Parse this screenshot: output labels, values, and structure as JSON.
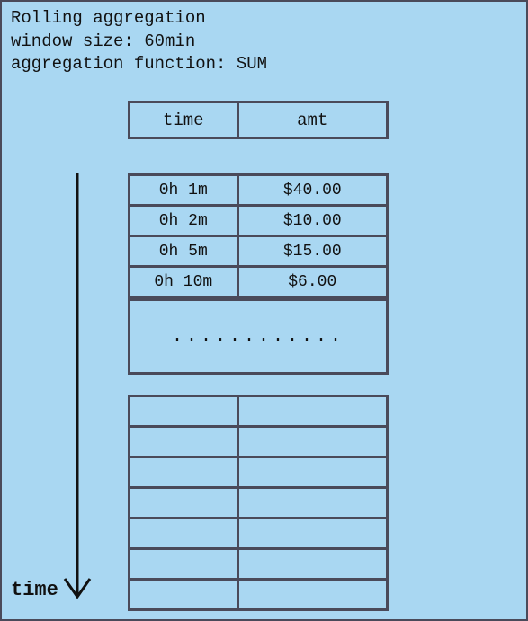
{
  "header": {
    "title": "Rolling aggregation",
    "window_line": "window size: 60min",
    "agg_line": "aggregation function: SUM"
  },
  "axis": {
    "label": "time"
  },
  "columns": {
    "time": "time",
    "amt": "amt"
  },
  "rows": [
    {
      "time": "0h 1m",
      "amt": "$40.00"
    },
    {
      "time": "0h 2m",
      "amt": "$10.00"
    },
    {
      "time": "0h 5m",
      "amt": "$15.00"
    },
    {
      "time": "0h 10m",
      "amt": "$6.00"
    }
  ],
  "ellipsis": "............",
  "empty_row_count": 7,
  "chart_data": {
    "type": "table",
    "title": "Rolling aggregation",
    "window_size_minutes": 60,
    "aggregation_function": "SUM",
    "columns": [
      "time",
      "amt"
    ],
    "data": [
      {
        "time": "0h 1m",
        "amt": 40.0
      },
      {
        "time": "0h 2m",
        "amt": 10.0
      },
      {
        "time": "0h 5m",
        "amt": 15.0
      },
      {
        "time": "0h 10m",
        "amt": 6.0
      }
    ]
  }
}
